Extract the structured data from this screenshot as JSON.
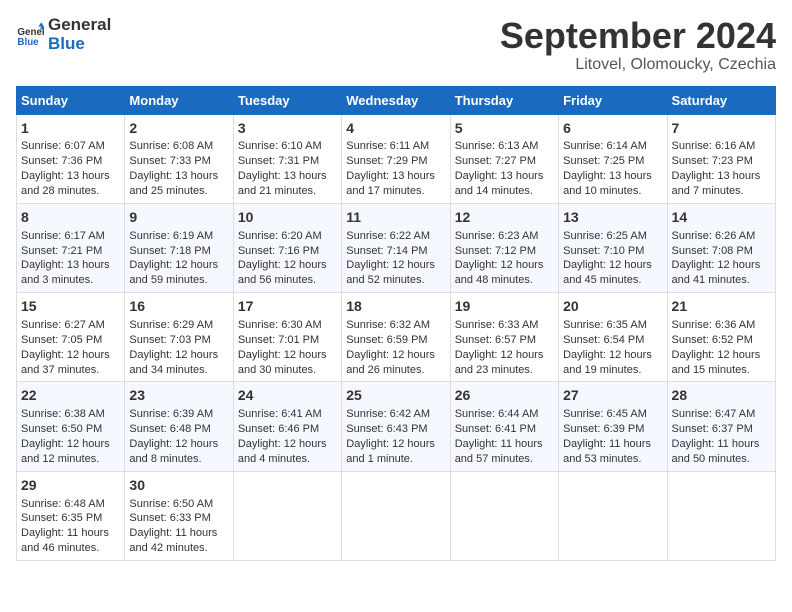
{
  "logo": {
    "line1": "General",
    "line2": "Blue"
  },
  "title": "September 2024",
  "subtitle": "Litovel, Olomoucky, Czechia",
  "headers": [
    "Sunday",
    "Monday",
    "Tuesday",
    "Wednesday",
    "Thursday",
    "Friday",
    "Saturday"
  ],
  "weeks": [
    [
      {
        "day": "1",
        "sunrise": "Sunrise: 6:07 AM",
        "sunset": "Sunset: 7:36 PM",
        "daylight": "Daylight: 13 hours and 28 minutes."
      },
      {
        "day": "2",
        "sunrise": "Sunrise: 6:08 AM",
        "sunset": "Sunset: 7:33 PM",
        "daylight": "Daylight: 13 hours and 25 minutes."
      },
      {
        "day": "3",
        "sunrise": "Sunrise: 6:10 AM",
        "sunset": "Sunset: 7:31 PM",
        "daylight": "Daylight: 13 hours and 21 minutes."
      },
      {
        "day": "4",
        "sunrise": "Sunrise: 6:11 AM",
        "sunset": "Sunset: 7:29 PM",
        "daylight": "Daylight: 13 hours and 17 minutes."
      },
      {
        "day": "5",
        "sunrise": "Sunrise: 6:13 AM",
        "sunset": "Sunset: 7:27 PM",
        "daylight": "Daylight: 13 hours and 14 minutes."
      },
      {
        "day": "6",
        "sunrise": "Sunrise: 6:14 AM",
        "sunset": "Sunset: 7:25 PM",
        "daylight": "Daylight: 13 hours and 10 minutes."
      },
      {
        "day": "7",
        "sunrise": "Sunrise: 6:16 AM",
        "sunset": "Sunset: 7:23 PM",
        "daylight": "Daylight: 13 hours and 7 minutes."
      }
    ],
    [
      {
        "day": "8",
        "sunrise": "Sunrise: 6:17 AM",
        "sunset": "Sunset: 7:21 PM",
        "daylight": "Daylight: 13 hours and 3 minutes."
      },
      {
        "day": "9",
        "sunrise": "Sunrise: 6:19 AM",
        "sunset": "Sunset: 7:18 PM",
        "daylight": "Daylight: 12 hours and 59 minutes."
      },
      {
        "day": "10",
        "sunrise": "Sunrise: 6:20 AM",
        "sunset": "Sunset: 7:16 PM",
        "daylight": "Daylight: 12 hours and 56 minutes."
      },
      {
        "day": "11",
        "sunrise": "Sunrise: 6:22 AM",
        "sunset": "Sunset: 7:14 PM",
        "daylight": "Daylight: 12 hours and 52 minutes."
      },
      {
        "day": "12",
        "sunrise": "Sunrise: 6:23 AM",
        "sunset": "Sunset: 7:12 PM",
        "daylight": "Daylight: 12 hours and 48 minutes."
      },
      {
        "day": "13",
        "sunrise": "Sunrise: 6:25 AM",
        "sunset": "Sunset: 7:10 PM",
        "daylight": "Daylight: 12 hours and 45 minutes."
      },
      {
        "day": "14",
        "sunrise": "Sunrise: 6:26 AM",
        "sunset": "Sunset: 7:08 PM",
        "daylight": "Daylight: 12 hours and 41 minutes."
      }
    ],
    [
      {
        "day": "15",
        "sunrise": "Sunrise: 6:27 AM",
        "sunset": "Sunset: 7:05 PM",
        "daylight": "Daylight: 12 hours and 37 minutes."
      },
      {
        "day": "16",
        "sunrise": "Sunrise: 6:29 AM",
        "sunset": "Sunset: 7:03 PM",
        "daylight": "Daylight: 12 hours and 34 minutes."
      },
      {
        "day": "17",
        "sunrise": "Sunrise: 6:30 AM",
        "sunset": "Sunset: 7:01 PM",
        "daylight": "Daylight: 12 hours and 30 minutes."
      },
      {
        "day": "18",
        "sunrise": "Sunrise: 6:32 AM",
        "sunset": "Sunset: 6:59 PM",
        "daylight": "Daylight: 12 hours and 26 minutes."
      },
      {
        "day": "19",
        "sunrise": "Sunrise: 6:33 AM",
        "sunset": "Sunset: 6:57 PM",
        "daylight": "Daylight: 12 hours and 23 minutes."
      },
      {
        "day": "20",
        "sunrise": "Sunrise: 6:35 AM",
        "sunset": "Sunset: 6:54 PM",
        "daylight": "Daylight: 12 hours and 19 minutes."
      },
      {
        "day": "21",
        "sunrise": "Sunrise: 6:36 AM",
        "sunset": "Sunset: 6:52 PM",
        "daylight": "Daylight: 12 hours and 15 minutes."
      }
    ],
    [
      {
        "day": "22",
        "sunrise": "Sunrise: 6:38 AM",
        "sunset": "Sunset: 6:50 PM",
        "daylight": "Daylight: 12 hours and 12 minutes."
      },
      {
        "day": "23",
        "sunrise": "Sunrise: 6:39 AM",
        "sunset": "Sunset: 6:48 PM",
        "daylight": "Daylight: 12 hours and 8 minutes."
      },
      {
        "day": "24",
        "sunrise": "Sunrise: 6:41 AM",
        "sunset": "Sunset: 6:46 PM",
        "daylight": "Daylight: 12 hours and 4 minutes."
      },
      {
        "day": "25",
        "sunrise": "Sunrise: 6:42 AM",
        "sunset": "Sunset: 6:43 PM",
        "daylight": "Daylight: 12 hours and 1 minute."
      },
      {
        "day": "26",
        "sunrise": "Sunrise: 6:44 AM",
        "sunset": "Sunset: 6:41 PM",
        "daylight": "Daylight: 11 hours and 57 minutes."
      },
      {
        "day": "27",
        "sunrise": "Sunrise: 6:45 AM",
        "sunset": "Sunset: 6:39 PM",
        "daylight": "Daylight: 11 hours and 53 minutes."
      },
      {
        "day": "28",
        "sunrise": "Sunrise: 6:47 AM",
        "sunset": "Sunset: 6:37 PM",
        "daylight": "Daylight: 11 hours and 50 minutes."
      }
    ],
    [
      {
        "day": "29",
        "sunrise": "Sunrise: 6:48 AM",
        "sunset": "Sunset: 6:35 PM",
        "daylight": "Daylight: 11 hours and 46 minutes."
      },
      {
        "day": "30",
        "sunrise": "Sunrise: 6:50 AM",
        "sunset": "Sunset: 6:33 PM",
        "daylight": "Daylight: 11 hours and 42 minutes."
      },
      {
        "day": "",
        "sunrise": "",
        "sunset": "",
        "daylight": ""
      },
      {
        "day": "",
        "sunrise": "",
        "sunset": "",
        "daylight": ""
      },
      {
        "day": "",
        "sunrise": "",
        "sunset": "",
        "daylight": ""
      },
      {
        "day": "",
        "sunrise": "",
        "sunset": "",
        "daylight": ""
      },
      {
        "day": "",
        "sunrise": "",
        "sunset": "",
        "daylight": ""
      }
    ]
  ]
}
